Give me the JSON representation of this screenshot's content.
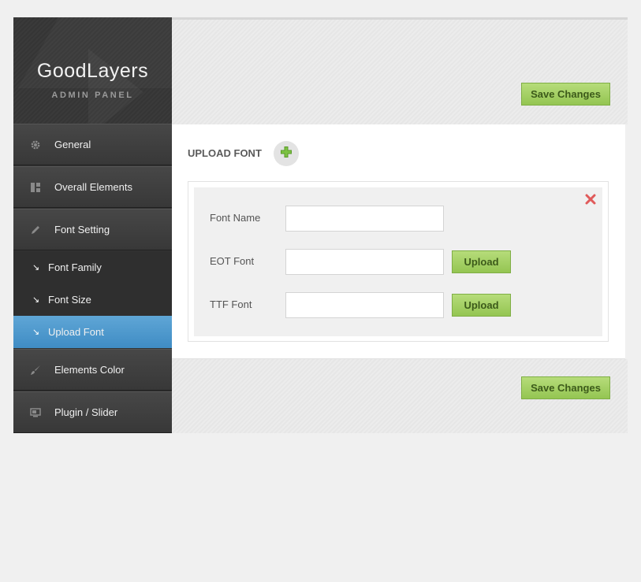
{
  "logo": {
    "title": "GoodLayers",
    "subtitle": "ADMIN PANEL"
  },
  "sidebar": {
    "items": [
      {
        "label": "General",
        "icon": "gear-icon"
      },
      {
        "label": "Overall Elements",
        "icon": "layout-icon"
      },
      {
        "label": "Font Setting",
        "icon": "pencil-icon"
      },
      {
        "label": "Elements Color",
        "icon": "brush-icon"
      },
      {
        "label": "Plugin / Slider",
        "icon": "monitor-icon"
      }
    ],
    "subitems": [
      {
        "label": "Font Family",
        "active": false
      },
      {
        "label": "Font Size",
        "active": false
      },
      {
        "label": "Upload Font",
        "active": true
      }
    ]
  },
  "toolbar": {
    "save_label": "Save Changes"
  },
  "upload_font": {
    "title": "UPLOAD FONT",
    "fields": [
      {
        "label": "Font Name",
        "value": "",
        "has_upload": false
      },
      {
        "label": "EOT Font",
        "value": "",
        "has_upload": true
      },
      {
        "label": "TTF Font",
        "value": "",
        "has_upload": true
      }
    ],
    "upload_label": "Upload"
  },
  "colors": {
    "accent_green": "#94c552",
    "active_blue": "#4a96cc",
    "sidebar_dark": "#3a3a3a",
    "delete_red": "#e05a5a"
  }
}
